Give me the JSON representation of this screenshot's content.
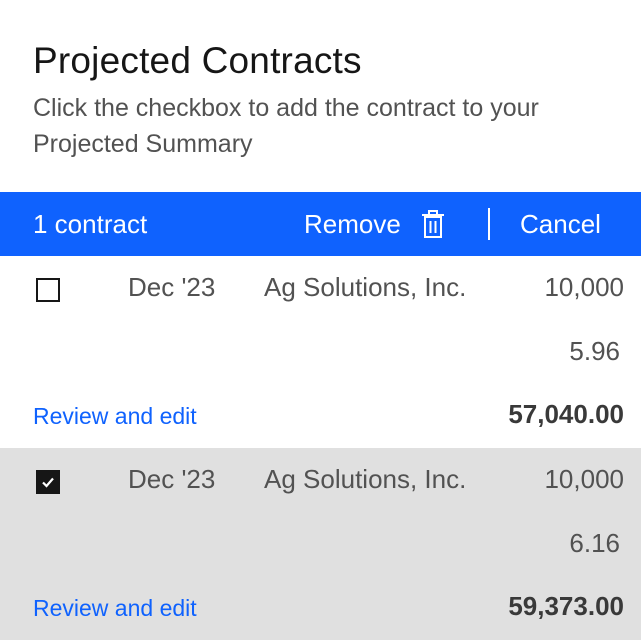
{
  "header": {
    "title": "Projected Contracts",
    "subtitle": "Click the checkbox to add the contract to your Projected Summary"
  },
  "action_bar": {
    "count_label": "1 contract",
    "remove_label": "Remove",
    "remove_icon": "trash-icon",
    "cancel_label": "Cancel",
    "background": "#0f62fe"
  },
  "contracts": [
    {
      "checked": false,
      "date": "Dec '23",
      "company": "Ag Solutions, Inc.",
      "quantity": "10,000",
      "price": "5.96",
      "review_label": "Review and edit",
      "total": "57,040.00"
    },
    {
      "checked": true,
      "date": "Dec '23",
      "company": "Ag Solutions, Inc.",
      "quantity": "10,000",
      "price": "6.16",
      "review_label": "Review and edit",
      "total": "59,373.00"
    }
  ],
  "colors": {
    "accent": "#0f62fe",
    "selected_row": "#e0e0e0"
  }
}
